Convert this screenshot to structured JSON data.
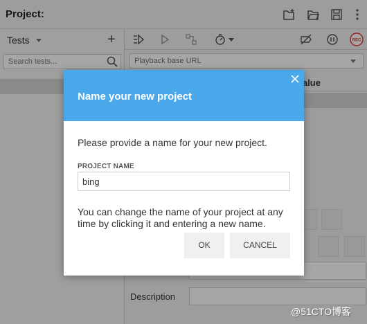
{
  "app": {
    "project_label": "Project:",
    "tests_label": "Tests",
    "search_placeholder": "Search tests...",
    "playback_placeholder": "Playback base URL",
    "value_header": "Value",
    "description_label": "Description"
  },
  "modal": {
    "title": "Name your new project",
    "prompt": "Please provide a name for your new project.",
    "field_label": "PROJECT NAME",
    "field_value": "bing",
    "hint": "You can change the name of your project at any time by clicking it and entering a new name.",
    "ok_label": "OK",
    "cancel_label": "CANCEL"
  },
  "colors": {
    "header_blue": "#4ba8ea",
    "record_red": "#e53935"
  },
  "watermark": "@51CTO博客"
}
